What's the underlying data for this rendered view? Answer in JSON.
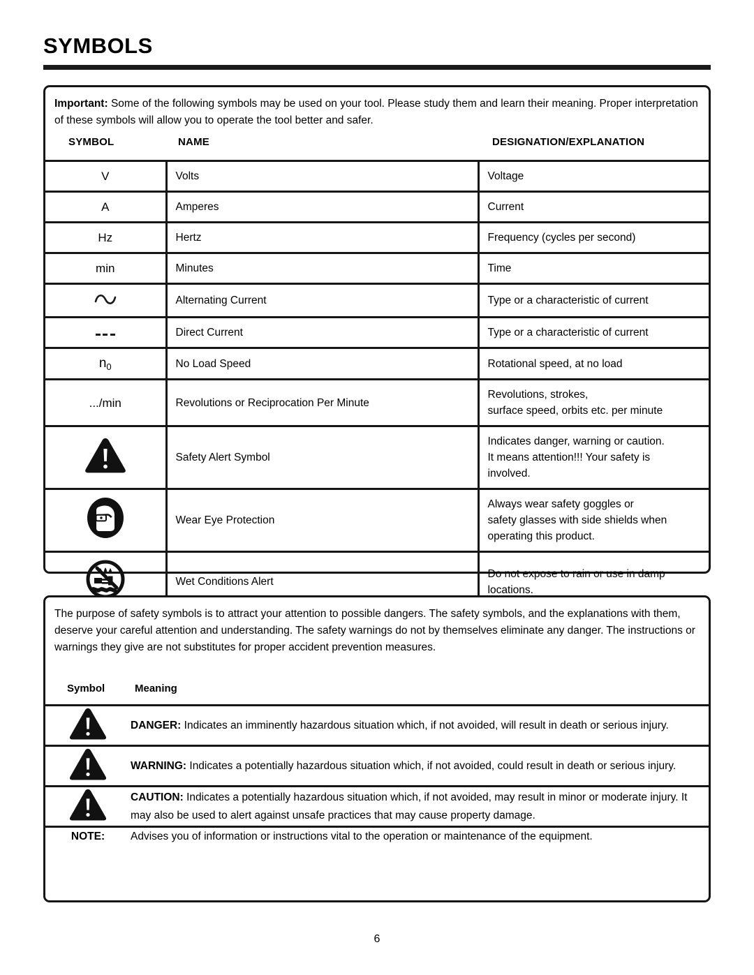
{
  "page_title": "SYMBOLS",
  "page_number": "6",
  "symbols_panel": {
    "intro_bold": "Important:",
    "intro_text": " Some of the following symbols may be used on your tool. Please study them and learn their meaning. Proper interpretation of these symbols will allow you to operate the tool better and safer.",
    "headers": {
      "symbol": "SYMBOL",
      "name": "NAME",
      "designation": "DESIGNATION/EXPLANATION"
    },
    "rows": [
      {
        "symbol": "V",
        "icon": "text-symbol-volts",
        "name": "Volts",
        "designation": "Voltage"
      },
      {
        "symbol": "A",
        "icon": "text-symbol-amperes",
        "name": "Amperes",
        "designation": "Current"
      },
      {
        "symbol": "Hz",
        "icon": "text-symbol-hertz",
        "name": "Hertz",
        "designation": "Frequency (cycles per second)"
      },
      {
        "symbol": "min",
        "icon": "text-symbol-minutes",
        "name": "Minutes",
        "designation": "Time"
      },
      {
        "symbol": "∿",
        "icon": "alternating-current-icon",
        "name": "Alternating Current",
        "designation": "Type or a characteristic of current"
      },
      {
        "symbol": "",
        "icon": "direct-current-icon",
        "name": "Direct Current",
        "designation": "Type or a characteristic of current"
      },
      {
        "symbol": "n0",
        "icon": "no-load-speed-icon",
        "name": "No Load Speed",
        "designation": "Rotational speed, at no load"
      },
      {
        "symbol": ".../min",
        "icon": "text-symbol-per-minute",
        "name": "Revolutions or Reciprocation Per Minute",
        "designation_line1": "Revolutions, strokes,",
        "designation_line2": "surface speed, orbits etc. per minute"
      },
      {
        "symbol": "",
        "icon": "safety-alert-triangle-icon",
        "name": "Safety Alert Symbol",
        "designation_line1": "Indicates danger, warning or caution.",
        "designation_line2": "It means attention!!! Your safety is",
        "designation_line3": "involved."
      },
      {
        "symbol": "",
        "icon": "wear-eye-protection-icon",
        "name": "Wear Eye Protection",
        "designation_line1": "Always wear safety goggles or",
        "designation_line2": "safety glasses with side shields when",
        "designation_line3": "operating this product."
      },
      {
        "symbol": "",
        "icon": "wet-conditions-alert-icon",
        "name": "Wet Conditions Alert",
        "designation_line1": "Do not expose to rain or use in damp",
        "designation_line2": "locations."
      }
    ]
  },
  "meanings_panel": {
    "purpose_text": "The purpose of safety symbols is to attract your attention to possible dangers. The safety symbols, and the explanations with them, deserve your careful attention and understanding. The safety warnings do not by themselves eliminate any danger. The instructions or warnings they give are not substitutes for proper accident prevention measures.",
    "headers": {
      "symbol": "Symbol",
      "meaning": "Meaning"
    },
    "rows": [
      {
        "icon": "safety-alert-triangle-icon",
        "label": "DANGER:",
        "text": " Indicates an imminently hazardous situation which, if not avoided, will result in death or serious injury."
      },
      {
        "icon": "safety-alert-triangle-icon",
        "label": "WARNING:",
        "text": " Indicates a potentially hazardous situation which, if not avoided, could result in death or serious injury."
      },
      {
        "icon": "safety-alert-triangle-icon",
        "label": "CAUTION:",
        "text": " Indicates a potentially hazardous situation which, if not avoided, may result in minor or moderate injury. It may also be used to alert against unsafe practices that may cause property damage."
      },
      {
        "icon": "none",
        "label": "NOTE:",
        "text": "Advises you of information or instructions vital to the operation or maintenance of the equipment."
      }
    ]
  },
  "colors": {
    "ink": "#000000",
    "rule": "#161616",
    "paper": "#ffffff"
  }
}
